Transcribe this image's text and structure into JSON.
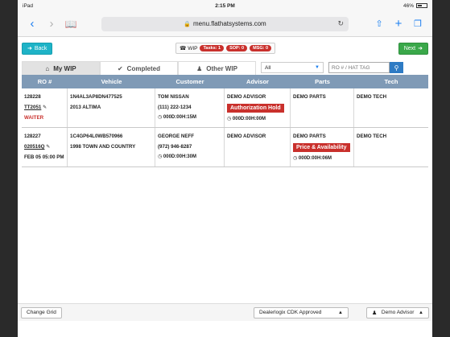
{
  "statusbar": {
    "device": "iPad",
    "time": "2:15 PM",
    "battery": "46%"
  },
  "browser": {
    "url": "menu.flathatsystems.com",
    "back_icon": "‹",
    "forward_icon": "›"
  },
  "appnav": {
    "back_label": "Back",
    "next_label": "Next",
    "wip_label": "WIP",
    "badges": {
      "tasks": "Tasks: 1",
      "sop": "SOP: 0",
      "msg": "MSG: 0"
    }
  },
  "tabs": {
    "my_wip": "My WIP",
    "completed": "Completed",
    "other_wip": "Other WIP",
    "filter_value": "All",
    "search_placeholder": "RO # / HAT TAG"
  },
  "grid": {
    "headers": [
      "RO #",
      "Vehicle",
      "Customer",
      "Advisor",
      "Parts",
      "Tech"
    ],
    "rows": [
      {
        "ro": "128228",
        "tag": "TT2051",
        "note": "WAITER",
        "vin": "1N4AL3AP8DN477525",
        "vehicle": "2013 ALTIMA",
        "customer": "TOM NISSAN",
        "phone": "(111) 222-1234",
        "customer_time": "000D:00H:15M",
        "advisor": "DEMO ADVISOR",
        "advisor_status": "Authorization Hold",
        "advisor_time": "000D:00H:00M",
        "parts": "DEMO PARTS",
        "tech": "DEMO TECH"
      },
      {
        "ro": "128227",
        "tag": "020516Q",
        "note": "FEB 05 05:00 PM",
        "vin": "1C4GP64L0WB570966",
        "vehicle": "1998 TOWN AND COUNTRY",
        "customer": "GEORGE NEFF",
        "phone": "(972) 946-8287",
        "customer_time": "000D:00H:30M",
        "advisor": "DEMO ADVISOR",
        "parts": "DEMO PARTS",
        "parts_status": "Price & Availability",
        "parts_time": "000D:00H:06M",
        "tech": "DEMO TECH"
      }
    ]
  },
  "bottombar": {
    "change_grid": "Change Grid",
    "dealer": "Dealerlogix CDK Approved",
    "advisor": "Demo Advisor"
  },
  "colors": {
    "header_blue": "#7f9ab6",
    "status_red": "#c9302c",
    "button_green": "#3aa84a",
    "back_teal": "#1eb3c7",
    "search_blue": "#2e7bc4"
  }
}
